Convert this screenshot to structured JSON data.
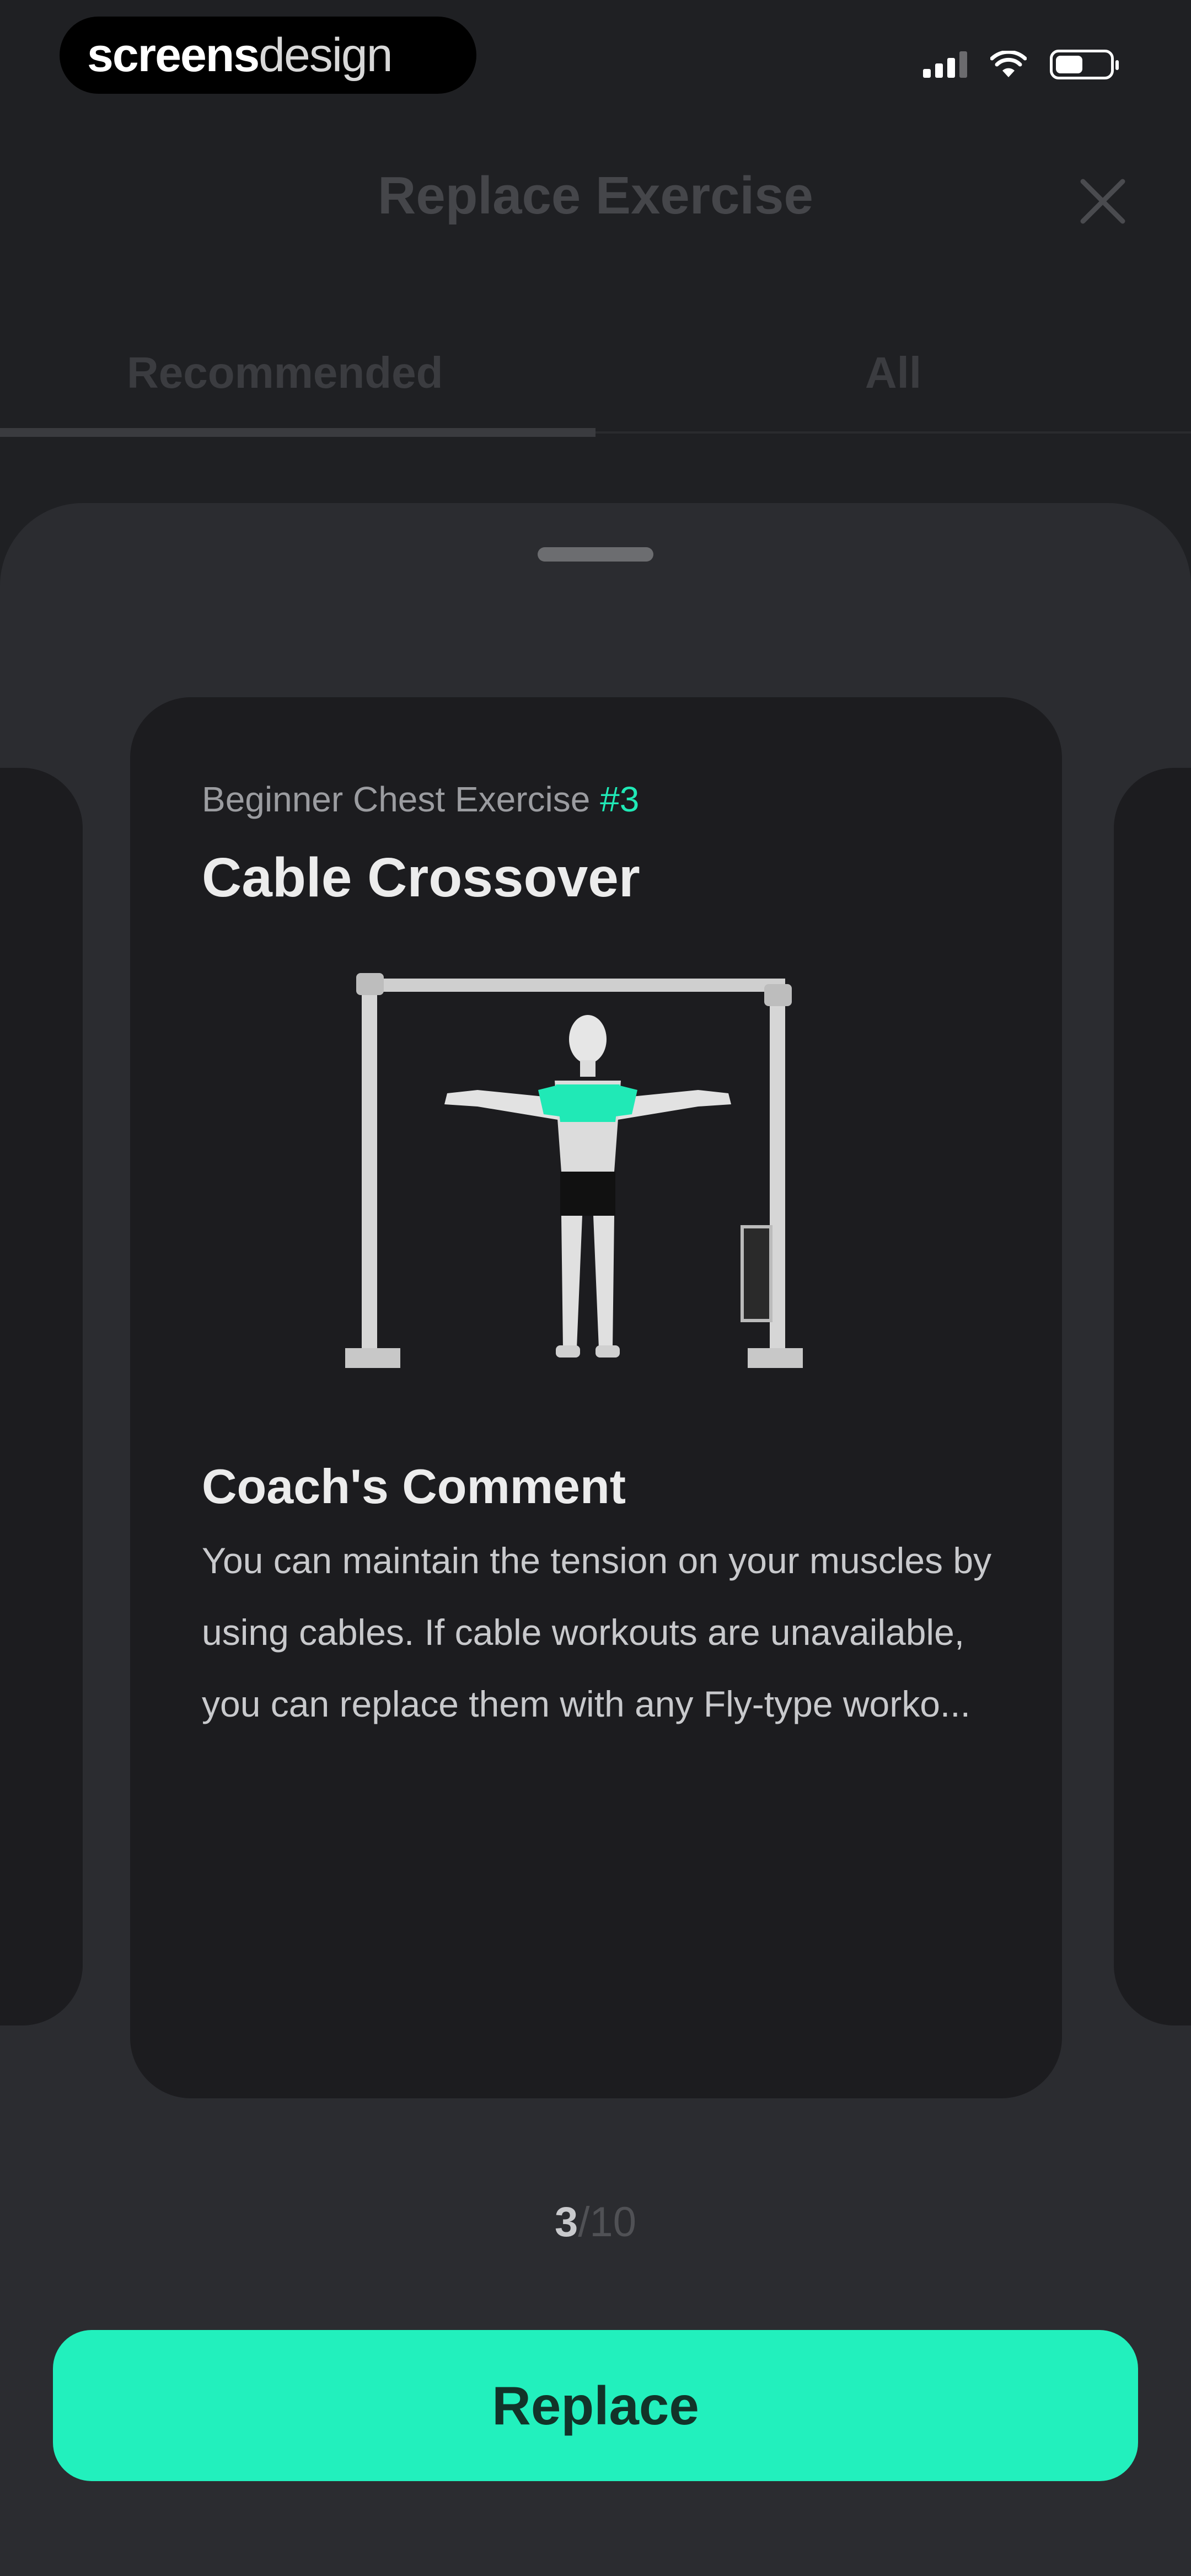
{
  "status_bar": {
    "brand_bold": "screens",
    "brand_light": "design"
  },
  "header": {
    "title": "Replace Exercise"
  },
  "tabs": [
    {
      "label": "Recommended",
      "selected": true
    },
    {
      "label": "All",
      "selected": false
    }
  ],
  "card": {
    "subtitle": "Beginner Chest Exercise",
    "rank": "#3",
    "title": "Cable Crossover",
    "comment_title": "Coach's Comment",
    "comment_body": "You can maintain the tension on your muscles by using cables. If cable workouts are unavailable, you can replace them with any Fly-type worko..."
  },
  "pager": {
    "current": "3",
    "total": "/10"
  },
  "actions": {
    "replace_label": "Replace"
  },
  "colors": {
    "accent": "#22f0bd",
    "background": "#1f2023",
    "sheet": "#2b2c30",
    "card": "#1c1c1f"
  }
}
